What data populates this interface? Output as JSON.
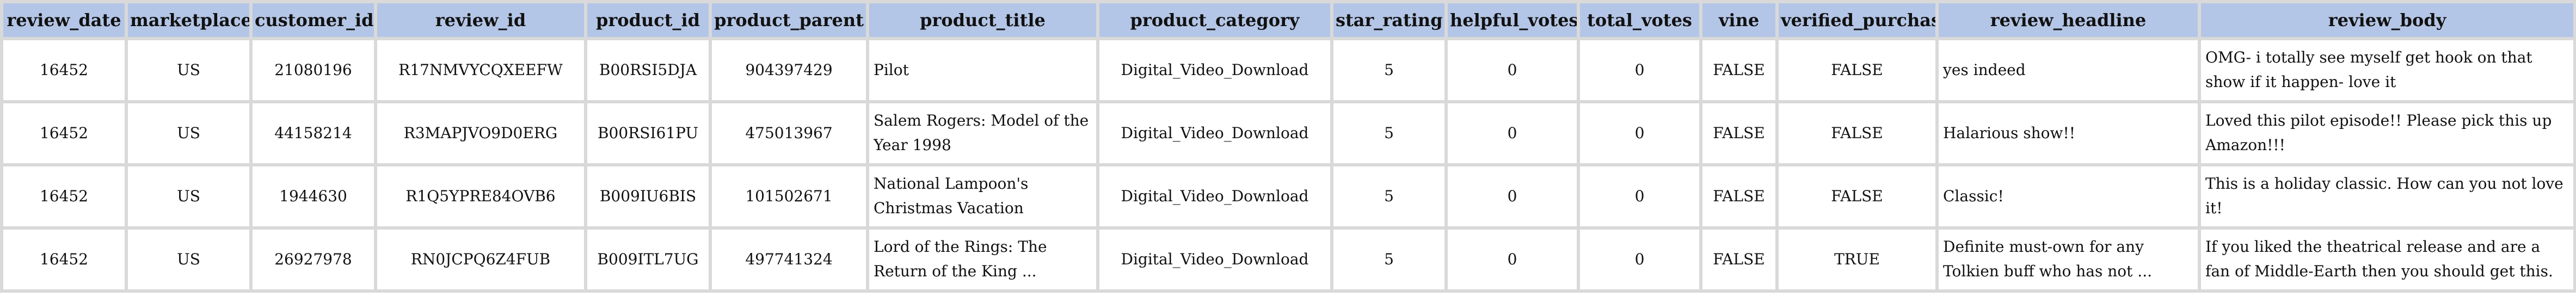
{
  "columns": [
    "review_date",
    "marketplace",
    "customer_id",
    "review_id",
    "product_id",
    "product_parent",
    "product_title",
    "product_category",
    "star_rating",
    "helpful_votes",
    "total_votes",
    "vine",
    "verified_purchase",
    "review_headline",
    "review_body"
  ],
  "rows": [
    {
      "review_date": "16452",
      "marketplace": "US",
      "customer_id": "21080196",
      "review_id": "R17NMVYCQXEEFW",
      "product_id": "B00RSI5DJA",
      "product_parent": "904397429",
      "product_title": "Pilot",
      "product_category": "Digital_Video_Download",
      "star_rating": "5",
      "helpful_votes": "0",
      "total_votes": "0",
      "vine": "FALSE",
      "verified_purchase": "FALSE",
      "review_headline": "yes indeed",
      "review_body": "OMG- i totally see myself get hook on that show if it happen- love it"
    },
    {
      "review_date": "16452",
      "marketplace": "US",
      "customer_id": "44158214",
      "review_id": "R3MAPJVO9D0ERG",
      "product_id": "B00RSI61PU",
      "product_parent": "475013967",
      "product_title": "Salem Rogers: Model of the Year 1998",
      "product_category": "Digital_Video_Download",
      "star_rating": "5",
      "helpful_votes": "0",
      "total_votes": "0",
      "vine": "FALSE",
      "verified_purchase": "FALSE",
      "review_headline": "Halarious show!!",
      "review_body": "Loved this pilot episode!! Please pick this up Amazon!!!"
    },
    {
      "review_date": "16452",
      "marketplace": "US",
      "customer_id": "1944630",
      "review_id": "R1Q5YPRE84OVB6",
      "product_id": "B009IU6BIS",
      "product_parent": "101502671",
      "product_title": "National Lampoon's Christmas Vacation",
      "product_category": "Digital_Video_Download",
      "star_rating": "5",
      "helpful_votes": "0",
      "total_votes": "0",
      "vine": "FALSE",
      "verified_purchase": "FALSE",
      "review_headline": "Classic!",
      "review_body": "This is a holiday classic. How can you not love it!"
    },
    {
      "review_date": "16452",
      "marketplace": "US",
      "customer_id": "26927978",
      "review_id": "RN0JCPQ6Z4FUB",
      "product_id": "B009ITL7UG",
      "product_parent": "497741324",
      "product_title": "Lord of the Rings: The Return of the King ...",
      "product_category": "Digital_Video_Download",
      "star_rating": "5",
      "helpful_votes": "0",
      "total_votes": "0",
      "vine": "FALSE",
      "verified_purchase": "TRUE",
      "review_headline": "Definite must-own for any Tolkien buff who has not ...",
      "review_body": "If you liked the theatrical release and are a fan of Middle-Earth then you should get this."
    }
  ]
}
